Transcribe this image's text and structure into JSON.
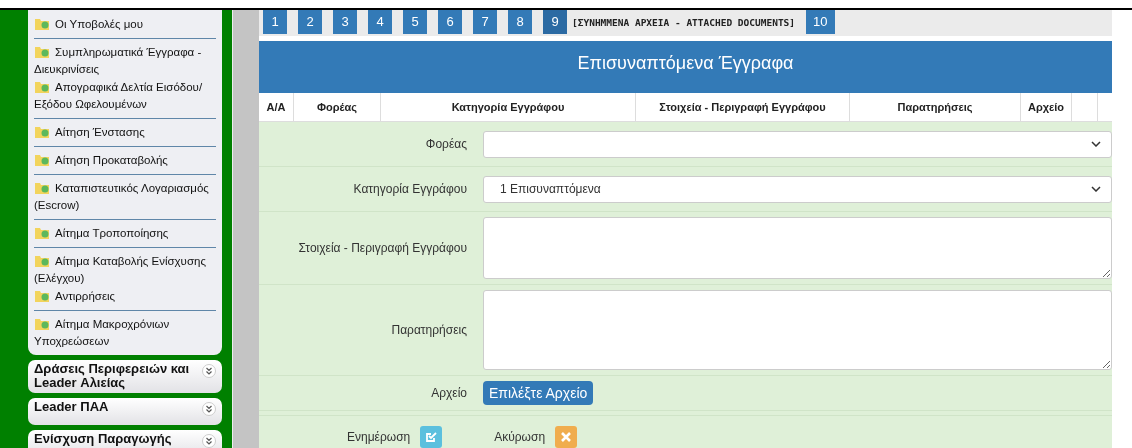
{
  "sidebar": {
    "items": [
      {
        "label": "Οι Υποβολές μου",
        "divider": true
      },
      {
        "label": "Συμπληρωματικά Έγγραφα - Διευκρινίσεις",
        "divider": false
      },
      {
        "label": "Απογραφικά Δελτία Εισόδου/ Εξόδου Ωφελουμένων",
        "divider": true
      },
      {
        "label": "Αίτηση Ένστασης",
        "divider": true
      },
      {
        "label": "Αίτηση Προκαταβολής",
        "divider": true
      },
      {
        "label": "Καταπιστευτικός Λογαριασμός (Escrow)",
        "divider": true
      },
      {
        "label": "Αίτημα Τροποποίησης",
        "divider": true
      },
      {
        "label": "Αίτημα Καταβολής Ενίσχυσης (Ελέγχου)",
        "divider": false
      },
      {
        "label": "Αντιρρήσεις",
        "divider": true
      },
      {
        "label": "Αίτημα Μακροχρόνιων Υποχρεώσεων",
        "divider": false
      }
    ],
    "sections": [
      {
        "label": "Δράσεις Περιφερειών και Leader Αλιείας",
        "expanded": false
      },
      {
        "label": "Leader ΠΑΑ",
        "expanded": false
      },
      {
        "label": "Ενίσχυση Παραγωγής",
        "expanded": false
      }
    ]
  },
  "tabs": [
    {
      "label": "1",
      "selected": false
    },
    {
      "label": "2",
      "selected": false
    },
    {
      "label": "3",
      "selected": false
    },
    {
      "label": "4",
      "selected": false
    },
    {
      "label": "5",
      "selected": false
    },
    {
      "label": "6",
      "selected": false
    },
    {
      "label": "7",
      "selected": false
    },
    {
      "label": "8",
      "selected": false
    },
    {
      "label": "9",
      "selected": true,
      "caption": "[ΣΥΝΗΜΜΕΝΑ ΑΡΧΕΙΑ - ATTACHED DOCUMENTS]"
    },
    {
      "label": "10",
      "selected": false
    }
  ],
  "panel": {
    "title": "Επισυναπτόμενα Έγγραφα"
  },
  "table": {
    "columns": [
      "Α/Α",
      "Φορέας",
      "Κατηγορία Εγγράφου",
      "Στοιχεία - Περιγραφή Εγγράφου",
      "Παρατηρήσεις",
      "Αρχείο"
    ]
  },
  "form": {
    "fields": [
      {
        "kind": "select",
        "label": "Φορέας"
      },
      {
        "kind": "select",
        "label": "Κατηγορία Εγγράφου",
        "value": "1 Επισυναπτόμενα"
      },
      {
        "kind": "textarea",
        "label": "Στοιχεία - Περιγραφή Εγγράφου"
      },
      {
        "kind": "textarea",
        "label": "Παρατηρήσεις"
      },
      {
        "kind": "file",
        "label": "Αρχείο",
        "button": "Επιλέξτε Αρχείο"
      }
    ],
    "actions": [
      {
        "kind": "update",
        "label": "Ενημέρωση"
      },
      {
        "kind": "cancel",
        "label": "Ακύρωση"
      }
    ]
  }
}
